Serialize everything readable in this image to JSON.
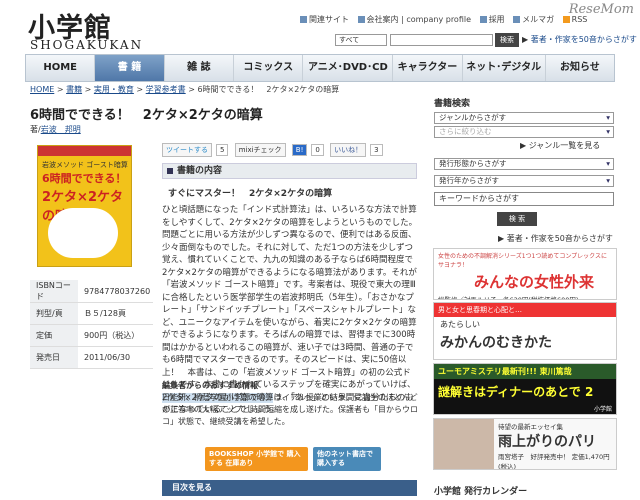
{
  "header": {
    "logo_jp": "小学館",
    "logo_en": "SHOGAKUKAN",
    "resemom": "ReseMom",
    "links": [
      "関連サイト",
      "会社案内",
      "company profile",
      "採用",
      "メルマガ",
      "RSS",
      "サイトマップ"
    ],
    "search_select": "すべて",
    "search_button": "検索",
    "advanced_link": "著者・作家を50音からさがす"
  },
  "nav": [
    "HOME",
    "書 籍",
    "雑 誌",
    "コミックス",
    "アニメ･DVD･CD",
    "キャラクター",
    "ネット･デジタル",
    "お知らせ"
  ],
  "breadcrumb": [
    "HOME",
    "書籍",
    "実用・教育",
    "学習参考書",
    "6時間でできる！　2ケタ×2ケタの暗算"
  ],
  "book": {
    "title": "6時間でできる！　2ケタ×2ケタの暗算",
    "author_prefix": "著/",
    "author": "岩波　邦明",
    "cover": {
      "top": "岩波メソッド ゴースト暗算",
      "line1": "6時間でできる！",
      "line2": "2ケタ×2ケタの暗算"
    },
    "info": [
      [
        "ISBNコード",
        "9784778037260"
      ],
      [
        "判型/頁",
        "Ｂ５/128頁"
      ],
      [
        "定価",
        "900円（税込）"
      ],
      [
        "発売日",
        "2011/06/30"
      ]
    ]
  },
  "social": {
    "tweet": "ツイートする",
    "tweet_count": "5",
    "mixi": "mixiチェック",
    "b_count": "0",
    "like": "いいね！",
    "like_count": "3"
  },
  "content": {
    "section": "書籍の内容",
    "subtitle": "すぐにマスター！　2ケタ×2ケタの暗算",
    "body_before": "ひと頃話題になった「インド式計算法」は、いろいろな方法で計算をしやすくして、2ケタ×2ケタの暗算をしようというものでした。問題ごとに用いる方法が少しずつ異なるので、便利ではある反面、少々面倒なものでした。それに対して、ただ1つの方法を少しずつ覚え、慣れていくことで、九九の知識のある子ならば6時間程度で2ケタ×2ケタの暗算ができるようになる暗算法があります。それが「岩波メソッド ゴースト暗算」です。考案者は、現役で東大の理Ⅲに合格したという医学部学生の岩波邦明氏（5年生）。「おさかなプレート」「サンドイッチプレート」「スペースシャトルプレート」など、ユニークなアイテムを使いながら、着実に2ケタ×2ケタの暗算ができるようになります。そろばんの暗算では、習得までに300時間はかかるといわれるこの暗算が、速い子では3時間、普通の子でも6時間でマスターできるのです。そのスピードは、実に50倍以上！　本書は、この「岩波メソッド ゴースト暗算」の初の公式ドリルです。本書に書かれているステップを確実にあがっていけば、",
    "body_hl": "2ケタ×2ケタのかけ算の暗算",
    "body_after": "は、「あっ」という間に自分たちのものになっていることでしょう。",
    "rec_head": "編集者からのおすすめ情報",
    "rec_body": "日能研、桐蔭学園小学部でのトライアル授業の結果、受講生のほとんどが正答率の大幅アップと時間短縮を成し遂げた。保護者も「目からウロコ」状態で、継続受講を希望した。",
    "buy1": "BOOKSHOP 小学館で 購入する 在庫あり",
    "buy2": "他のネット書店で 購入する",
    "toc": "目次を見る"
  },
  "sidebar": {
    "head": "書籍検索",
    "genre": "ジャンルからさがす",
    "narrow": "さらに絞り込む",
    "jp_search": "ジャンル一覧を見る",
    "month": "発行形態からさがす",
    "year": "発行年からさがす",
    "keyword": "キーワードからさがす",
    "button": "検 索",
    "author_link": "著者・作家を50音からさがす",
    "ads": [
      {
        "small": "女性のための不調解消シリーズ1つ1つ読めてコンプレックスにサヨナラ！",
        "big": "みんなの女性外来",
        "sub": "総監修／対馬ルリ子　各630円(税抜価格600円)"
      },
      {
        "small": "男と女と思春期と心配と…",
        "big": "みかんのむきかた",
        "sub": "あたらしい"
      },
      {
        "small": "ユーモアミステリ最新刊!!! 東川篤哉",
        "big": "謎解きはディナーのあとで 2",
        "sub": "小学館"
      },
      {
        "small": "待望の最新エッセイ集",
        "big": "雨上がりのパリ",
        "sub": "雨宮塔子　好評発売中！ 定価1,470円(税込)"
      }
    ],
    "calendar": "小学館 発行カレンダー"
  }
}
